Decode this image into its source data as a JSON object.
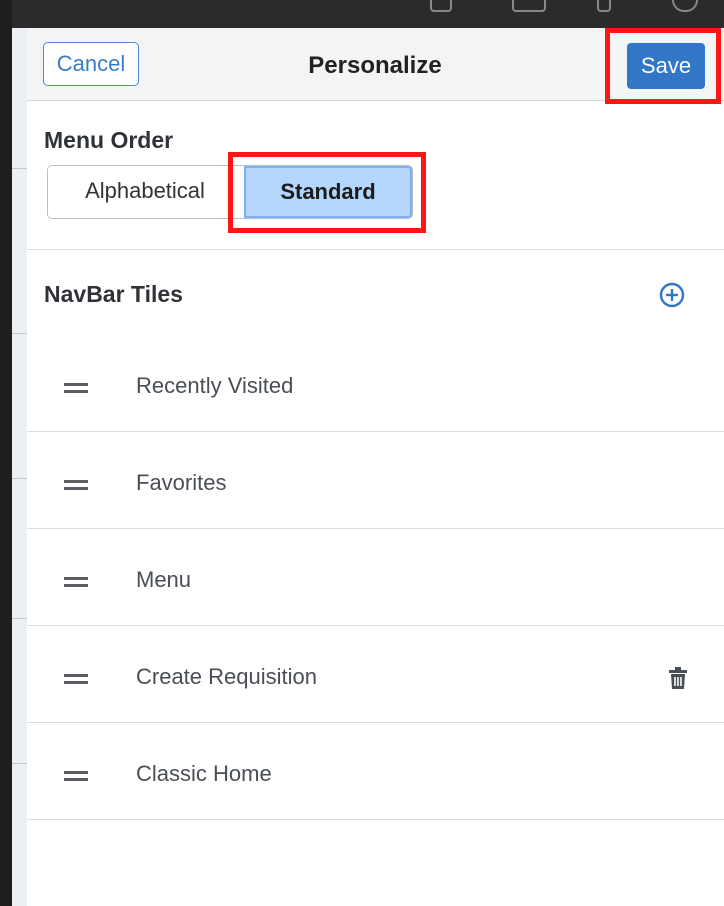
{
  "header": {
    "cancel_label": "Cancel",
    "title": "Personalize",
    "save_label": "Save"
  },
  "menu_order": {
    "label": "Menu Order",
    "options": [
      "Alphabetical",
      "Standard"
    ],
    "selected": "Standard"
  },
  "navbar_tiles": {
    "label": "NavBar Tiles",
    "add_icon": "add-circle-icon",
    "items": [
      {
        "label": "Recently Visited",
        "deletable": false
      },
      {
        "label": "Favorites",
        "deletable": false
      },
      {
        "label": "Menu",
        "deletable": false
      },
      {
        "label": "Create Requisition",
        "deletable": true
      },
      {
        "label": "Classic Home",
        "deletable": false
      }
    ]
  },
  "colors": {
    "accent": "#3276c8",
    "selected_segment": "#b5d6fb",
    "highlight": "#ff1515",
    "background": "#d8681f"
  }
}
